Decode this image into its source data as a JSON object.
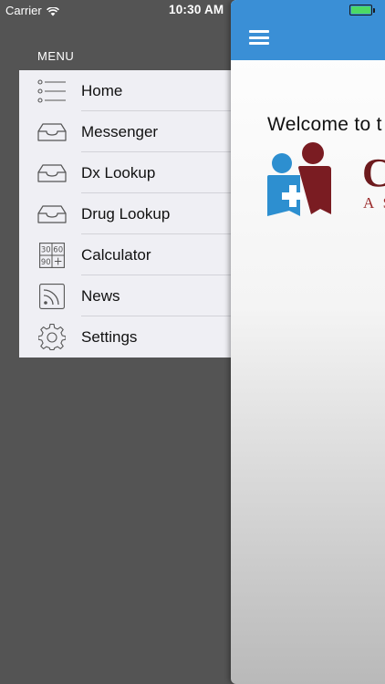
{
  "status_bar": {
    "carrier": "Carrier",
    "time": "10:30 AM",
    "battery_level": 1.0
  },
  "menu": {
    "title": "MENU",
    "items": [
      {
        "label": "Home",
        "icon": "list-icon"
      },
      {
        "label": "Messenger",
        "icon": "inbox-icon"
      },
      {
        "label": "Dx Lookup",
        "icon": "inbox-icon"
      },
      {
        "label": "Drug Lookup",
        "icon": "inbox-icon"
      },
      {
        "label": "Calculator",
        "icon": "calculator-icon"
      },
      {
        "label": "News",
        "icon": "rss-icon"
      },
      {
        "label": "Settings",
        "icon": "gear-icon"
      }
    ],
    "calculator_keys": [
      "30",
      "60",
      "90",
      "+"
    ]
  },
  "content": {
    "welcome_text": "Welcome to t",
    "brand_letter": "C",
    "brand_sub": "A S"
  },
  "colors": {
    "nav_bar": "#3a8fd6",
    "drawer_bg": "#545454",
    "menu_bg": "#efeff4",
    "logo_blue": "#2d8fd0",
    "logo_maroon": "#7a1c22"
  }
}
